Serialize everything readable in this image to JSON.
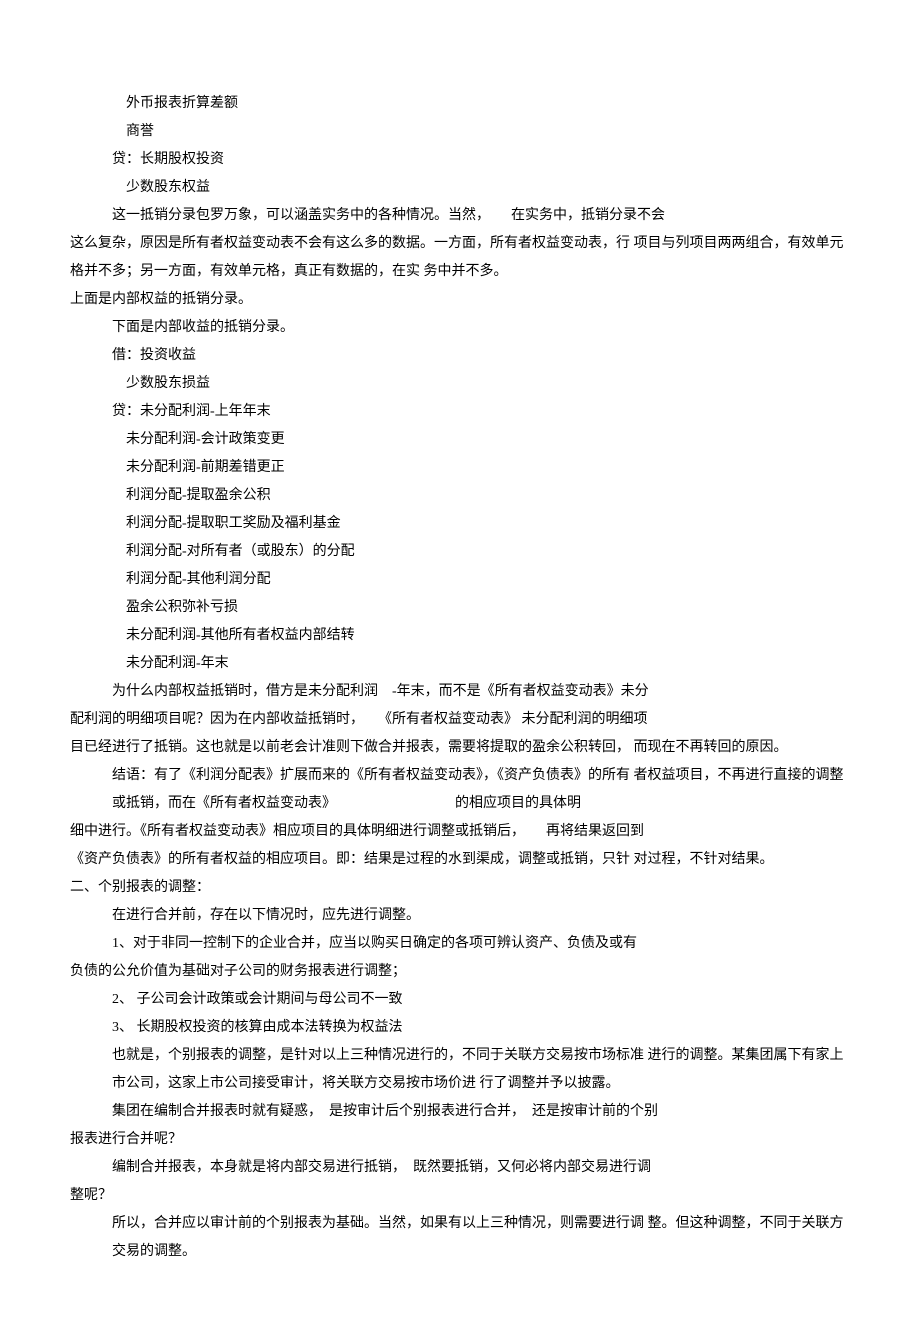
{
  "lines": [
    {
      "cls": "indent3",
      "text": "外币报表折算差额"
    },
    {
      "cls": "indent3",
      "text": "商誉"
    },
    {
      "cls": "indent2",
      "text": "贷：长期股权投资"
    },
    {
      "cls": "indent3",
      "text": "少数股东权益"
    },
    {
      "cls": "indent2",
      "text": "这一抵销分录包罗万象，可以涵盖实务中的各种情况。当然，　　在实务中，抵销分录不会"
    },
    {
      "cls": "",
      "text": "这么复杂，原因是所有者权益变动表不会有这么多的数据。一方面，所有者权益变动表，行 项目与列项目两两组合，有效单元格并不多；另一方面，有效单元格，真正有数据的，在实 务中并不多。"
    },
    {
      "cls": "",
      "text": "上面是内部权益的抵销分录。"
    },
    {
      "cls": "indent2",
      "text": "下面是内部收益的抵销分录。"
    },
    {
      "cls": "indent2",
      "text": "借：投资收益"
    },
    {
      "cls": "indent3",
      "text": "少数股东损益"
    },
    {
      "cls": "indent2",
      "text": "贷：未分配利润-上年年末"
    },
    {
      "cls": "indent3",
      "text": "未分配利润-会计政策变更"
    },
    {
      "cls": "indent3",
      "text": "未分配利润-前期差错更正"
    },
    {
      "cls": "indent3",
      "text": "利润分配-提取盈余公积"
    },
    {
      "cls": "indent3",
      "text": "利润分配-提取职工奖励及福利基金"
    },
    {
      "cls": "indent3",
      "text": "利润分配-对所有者（或股东）的分配"
    },
    {
      "cls": "indent3",
      "text": "利润分配-其他利润分配"
    },
    {
      "cls": "indent3",
      "text": "盈余公积弥补亏损"
    },
    {
      "cls": "indent3",
      "text": "未分配利润-其他所有者权益内部结转"
    },
    {
      "cls": "indent3",
      "text": "未分配利润-年末"
    },
    {
      "cls": "indent2",
      "text": "为什么内部权益抵销时，借方是未分配利润　-年末，而不是《所有者权益变动表》未分"
    },
    {
      "cls": "",
      "text": "配利润的明细项目呢？因为在内部收益抵销时，　　《所有者权益变动表》 未分配利润的明细项"
    },
    {
      "cls": "",
      "text": "目已经进行了抵销。这也就是以前老会计准则下做合并报表，需要将提取的盈余公积转回， 而现在不再转回的原因。"
    },
    {
      "cls": "indent2",
      "text": "结语：有了《利润分配表》扩展而来的《所有者权益变动表》，《资产负债表》的所有 者权益项目，不再进行直接的调整或抵销，而在《所有者权益变动表》　　　　　　　　　的相应项目的具体明"
    },
    {
      "cls": "",
      "text": "细中进行。《所有者权益变动表》相应项目的具体明细进行调整或抵销后，　　再将结果返回到"
    },
    {
      "cls": "",
      "text": "《资产负债表》的所有者权益的相应项目。即：结果是过程的水到渠成，调整或抵销，只针 对过程，不针对结果。"
    },
    {
      "cls": "",
      "text": "二、个别报表的调整："
    },
    {
      "cls": "indent2",
      "text": "在进行合并前，存在以下情况时，应先进行调整。"
    },
    {
      "cls": "indent2",
      "text": "1、对于非同一控制下的企业合并，应当以购买日确定的各项可辨认资产、负债及或有"
    },
    {
      "cls": "",
      "text": "负债的公允价值为基础对子公司的财务报表进行调整；"
    },
    {
      "cls": "indent2",
      "text": "2、 子公司会计政策或会计期间与母公司不一致"
    },
    {
      "cls": "indent2",
      "text": "3、 长期股权投资的核算由成本法转换为权益法"
    },
    {
      "cls": "indent2",
      "text": "也就是，个别报表的调整，是针对以上三种情况进行的，不同于关联方交易按市场标准 进行的调整。某集团属下有家上市公司，这家上市公司接受审计，将关联方交易按市场价进 行了调整并予以披露。"
    },
    {
      "cls": "indent2",
      "text": "集团在编制合并报表时就有疑惑，　是按审计后个别报表进行合并，　还是按审计前的个别"
    },
    {
      "cls": "",
      "text": "报表进行合并呢？"
    },
    {
      "cls": "indent2",
      "text": "编制合并报表，本身就是将内部交易进行抵销，　既然要抵销，又何必将内部交易进行调"
    },
    {
      "cls": "",
      "text": "整呢？"
    },
    {
      "cls": "indent2",
      "text": "所以，合并应以审计前的个别报表为基础。当然，如果有以上三种情况，则需要进行调 整。但这种调整，不同于关联方交易的调整。"
    }
  ]
}
